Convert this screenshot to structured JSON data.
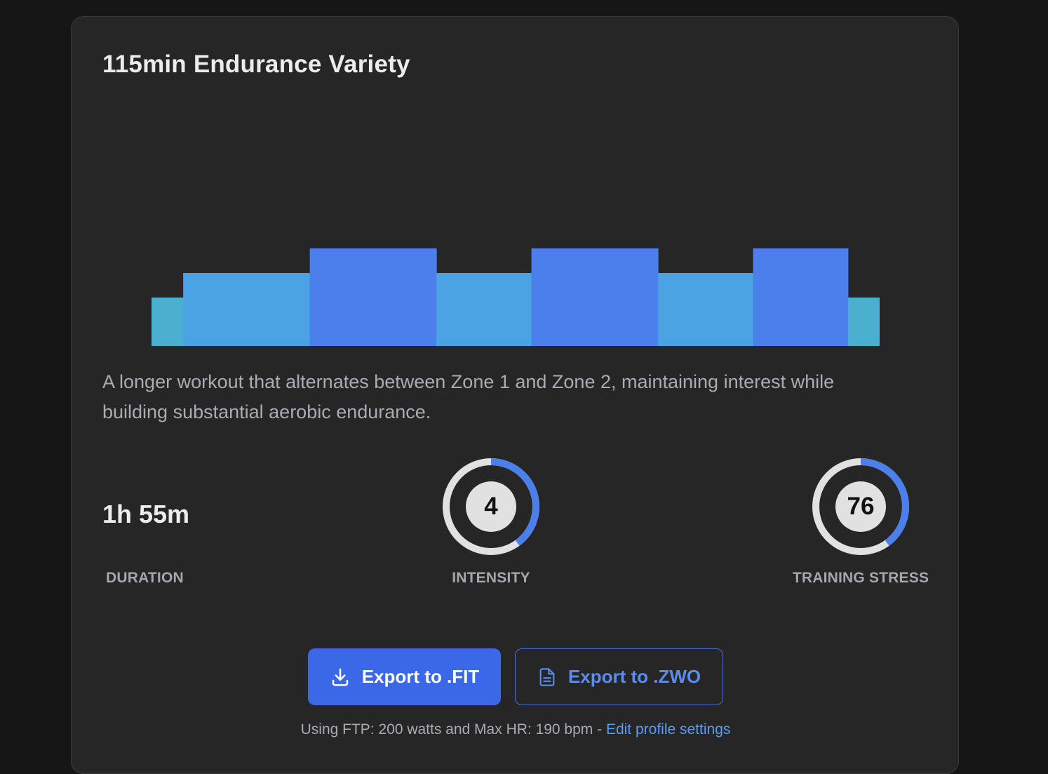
{
  "workout": {
    "title": "115min Endurance Variety",
    "description": "A longer workout that alternates between Zone 1 and Zone 2, maintaining interest while building substantial aerobic endurance."
  },
  "stats": {
    "duration": {
      "value": "1h 55m",
      "label": "DURATION"
    },
    "intensity": {
      "value": "4",
      "label": "INTENSITY",
      "fraction": 0.4
    },
    "training_stress": {
      "value": "76",
      "label": "TRAINING STRESS",
      "fraction": 0.4
    }
  },
  "buttons": {
    "export_fit": "Export to .FIT",
    "export_zwo": "Export to .ZWO"
  },
  "footer": {
    "text": "Using FTP: 200 watts and Max HR: 190 bpm - ",
    "link": "Edit profile settings"
  },
  "colors": {
    "zone1": "#4bafd0",
    "zone2": "#4aa3e2",
    "zone3": "#4b80ec",
    "gauge_track": "#e1e1e1",
    "gauge_fill": "#4b80ec"
  },
  "icons": {
    "fit": "download-icon",
    "zwo": "file-icon"
  },
  "chart_data": {
    "type": "bar",
    "segments": [
      {
        "minutes": 5,
        "zone": 1
      },
      {
        "minutes": 20,
        "zone": 2
      },
      {
        "minutes": 20,
        "zone": 3
      },
      {
        "minutes": 15,
        "zone": 2
      },
      {
        "minutes": 20,
        "zone": 3
      },
      {
        "minutes": 15,
        "zone": 2
      },
      {
        "minutes": 15,
        "zone": 3
      },
      {
        "minutes": 5,
        "zone": 1
      }
    ],
    "ylim": [
      0,
      3
    ]
  }
}
